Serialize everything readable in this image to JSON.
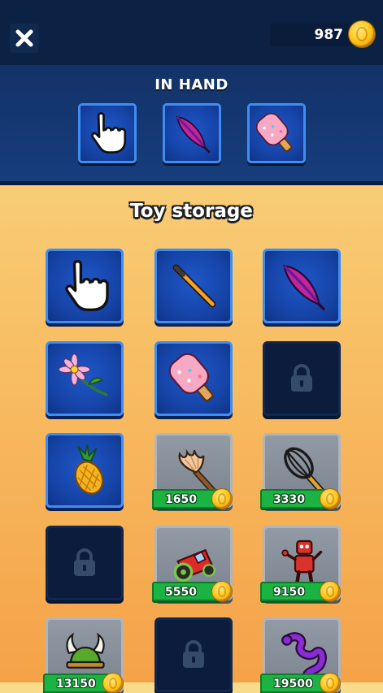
{
  "header": {
    "close_icon": "close-icon",
    "coins": "987",
    "coin_icon": "gold-coin-icon"
  },
  "in_hand": {
    "title": "IN HAND",
    "slots": [
      {
        "icon": "hand-pointer-icon"
      },
      {
        "icon": "purple-feather-icon"
      },
      {
        "icon": "pink-popsicle-icon"
      }
    ]
  },
  "storage": {
    "title": "Toy storage",
    "items": [
      {
        "state": "owned",
        "icon": "hand-pointer-icon"
      },
      {
        "state": "owned",
        "icon": "orange-stick-icon"
      },
      {
        "state": "owned",
        "icon": "purple-feather-icon"
      },
      {
        "state": "owned",
        "icon": "pink-flower-icon"
      },
      {
        "state": "owned",
        "icon": "pink-popsicle-icon"
      },
      {
        "state": "locked",
        "icon": "padlock-icon"
      },
      {
        "state": "owned",
        "icon": "pineapple-icon"
      },
      {
        "state": "buy",
        "icon": "feather-duster-icon",
        "price": "1650"
      },
      {
        "state": "buy",
        "icon": "whisk-icon",
        "price": "3330"
      },
      {
        "state": "locked",
        "icon": "padlock-icon"
      },
      {
        "state": "buy",
        "icon": "toy-tractor-icon",
        "price": "5550"
      },
      {
        "state": "buy",
        "icon": "toy-robot-icon",
        "price": "9150"
      },
      {
        "state": "buy",
        "icon": "viking-helmet-icon",
        "price": "13150"
      },
      {
        "state": "locked",
        "icon": "padlock-icon"
      },
      {
        "state": "buy",
        "icon": "purple-snake-icon",
        "price": "19500"
      }
    ]
  },
  "colors": {
    "top_bar": "#0c2244",
    "owned_tile": "#1644a8",
    "price_tag": "#1bb341",
    "coin": "#ffc81e"
  }
}
